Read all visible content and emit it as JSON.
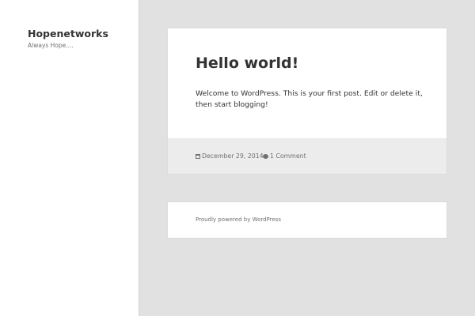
{
  "site": {
    "title": "Hopenetworks",
    "description": "Always Hope...."
  },
  "post": {
    "title": "Hello world!",
    "content": "Welcome to WordPress. This is your first post. Edit or delete it, then start blogging!",
    "date": "December 29, 2014",
    "comments": "1 Comment"
  },
  "footer": {
    "powered_by": "Proudly powered by WordPress"
  }
}
